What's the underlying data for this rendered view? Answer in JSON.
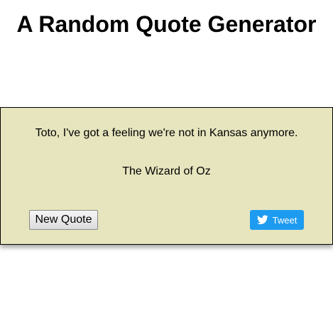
{
  "header": {
    "title": "A Random Quote Generator"
  },
  "quote": {
    "text": "Toto, I've got a feeling we're not in Kansas anymore.",
    "author": "The Wizard of Oz"
  },
  "actions": {
    "new_quote_label": "New Quote",
    "tweet_label": "Tweet",
    "tweet_icon": "twitter-bird-icon"
  },
  "colors": {
    "card_background": "#e6e5be",
    "tweet_button": "#1d9bf0"
  }
}
